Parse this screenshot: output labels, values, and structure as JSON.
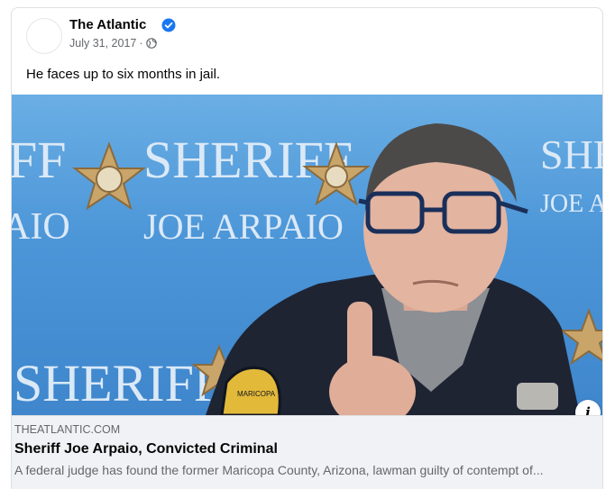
{
  "post": {
    "page_name": "The Atlantic",
    "verified_icon": "verified-badge-icon",
    "date": "July 31, 2017",
    "separator": "·",
    "audience_icon": "globe-icon",
    "text": "He faces up to six months in jail."
  },
  "photo": {
    "backdrop_text_sheriff": "SHERIFF",
    "backdrop_text_name": "JOE ARPAIO",
    "backdrop_fragment_left_1": "FF",
    "backdrop_fragment_left_2": "AIO",
    "backdrop_fragment_right_1": "SHER",
    "backdrop_fragment_right_2": "JOE ARP",
    "badge_text": "MARICOPA"
  },
  "link_preview": {
    "domain": "THEATLANTIC.COM",
    "title": "Sheriff Joe Arpaio, Convicted Criminal",
    "description": "A federal judge has found the former Maricopa County, Arizona, lawman guilty of contempt of...",
    "info_label": "i"
  },
  "colors": {
    "brand_blue": "#1877f2",
    "backdrop_blue": "#4c96d8",
    "uniform": "#1f2433"
  }
}
